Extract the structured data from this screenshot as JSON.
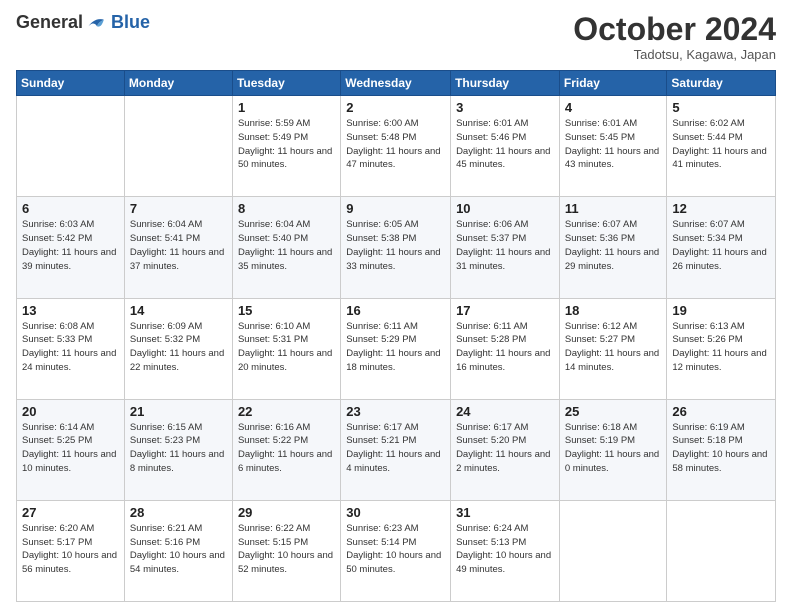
{
  "header": {
    "logo_general": "General",
    "logo_blue": "Blue",
    "month_title": "October 2024",
    "subtitle": "Tadotsu, Kagawa, Japan"
  },
  "days_of_week": [
    "Sunday",
    "Monday",
    "Tuesday",
    "Wednesday",
    "Thursday",
    "Friday",
    "Saturday"
  ],
  "weeks": [
    [
      {
        "day": "",
        "sunrise": "",
        "sunset": "",
        "daylight": ""
      },
      {
        "day": "",
        "sunrise": "",
        "sunset": "",
        "daylight": ""
      },
      {
        "day": "1",
        "sunrise": "Sunrise: 5:59 AM",
        "sunset": "Sunset: 5:49 PM",
        "daylight": "Daylight: 11 hours and 50 minutes."
      },
      {
        "day": "2",
        "sunrise": "Sunrise: 6:00 AM",
        "sunset": "Sunset: 5:48 PM",
        "daylight": "Daylight: 11 hours and 47 minutes."
      },
      {
        "day": "3",
        "sunrise": "Sunrise: 6:01 AM",
        "sunset": "Sunset: 5:46 PM",
        "daylight": "Daylight: 11 hours and 45 minutes."
      },
      {
        "day": "4",
        "sunrise": "Sunrise: 6:01 AM",
        "sunset": "Sunset: 5:45 PM",
        "daylight": "Daylight: 11 hours and 43 minutes."
      },
      {
        "day": "5",
        "sunrise": "Sunrise: 6:02 AM",
        "sunset": "Sunset: 5:44 PM",
        "daylight": "Daylight: 11 hours and 41 minutes."
      }
    ],
    [
      {
        "day": "6",
        "sunrise": "Sunrise: 6:03 AM",
        "sunset": "Sunset: 5:42 PM",
        "daylight": "Daylight: 11 hours and 39 minutes."
      },
      {
        "day": "7",
        "sunrise": "Sunrise: 6:04 AM",
        "sunset": "Sunset: 5:41 PM",
        "daylight": "Daylight: 11 hours and 37 minutes."
      },
      {
        "day": "8",
        "sunrise": "Sunrise: 6:04 AM",
        "sunset": "Sunset: 5:40 PM",
        "daylight": "Daylight: 11 hours and 35 minutes."
      },
      {
        "day": "9",
        "sunrise": "Sunrise: 6:05 AM",
        "sunset": "Sunset: 5:38 PM",
        "daylight": "Daylight: 11 hours and 33 minutes."
      },
      {
        "day": "10",
        "sunrise": "Sunrise: 6:06 AM",
        "sunset": "Sunset: 5:37 PM",
        "daylight": "Daylight: 11 hours and 31 minutes."
      },
      {
        "day": "11",
        "sunrise": "Sunrise: 6:07 AM",
        "sunset": "Sunset: 5:36 PM",
        "daylight": "Daylight: 11 hours and 29 minutes."
      },
      {
        "day": "12",
        "sunrise": "Sunrise: 6:07 AM",
        "sunset": "Sunset: 5:34 PM",
        "daylight": "Daylight: 11 hours and 26 minutes."
      }
    ],
    [
      {
        "day": "13",
        "sunrise": "Sunrise: 6:08 AM",
        "sunset": "Sunset: 5:33 PM",
        "daylight": "Daylight: 11 hours and 24 minutes."
      },
      {
        "day": "14",
        "sunrise": "Sunrise: 6:09 AM",
        "sunset": "Sunset: 5:32 PM",
        "daylight": "Daylight: 11 hours and 22 minutes."
      },
      {
        "day": "15",
        "sunrise": "Sunrise: 6:10 AM",
        "sunset": "Sunset: 5:31 PM",
        "daylight": "Daylight: 11 hours and 20 minutes."
      },
      {
        "day": "16",
        "sunrise": "Sunrise: 6:11 AM",
        "sunset": "Sunset: 5:29 PM",
        "daylight": "Daylight: 11 hours and 18 minutes."
      },
      {
        "day": "17",
        "sunrise": "Sunrise: 6:11 AM",
        "sunset": "Sunset: 5:28 PM",
        "daylight": "Daylight: 11 hours and 16 minutes."
      },
      {
        "day": "18",
        "sunrise": "Sunrise: 6:12 AM",
        "sunset": "Sunset: 5:27 PM",
        "daylight": "Daylight: 11 hours and 14 minutes."
      },
      {
        "day": "19",
        "sunrise": "Sunrise: 6:13 AM",
        "sunset": "Sunset: 5:26 PM",
        "daylight": "Daylight: 11 hours and 12 minutes."
      }
    ],
    [
      {
        "day": "20",
        "sunrise": "Sunrise: 6:14 AM",
        "sunset": "Sunset: 5:25 PM",
        "daylight": "Daylight: 11 hours and 10 minutes."
      },
      {
        "day": "21",
        "sunrise": "Sunrise: 6:15 AM",
        "sunset": "Sunset: 5:23 PM",
        "daylight": "Daylight: 11 hours and 8 minutes."
      },
      {
        "day": "22",
        "sunrise": "Sunrise: 6:16 AM",
        "sunset": "Sunset: 5:22 PM",
        "daylight": "Daylight: 11 hours and 6 minutes."
      },
      {
        "day": "23",
        "sunrise": "Sunrise: 6:17 AM",
        "sunset": "Sunset: 5:21 PM",
        "daylight": "Daylight: 11 hours and 4 minutes."
      },
      {
        "day": "24",
        "sunrise": "Sunrise: 6:17 AM",
        "sunset": "Sunset: 5:20 PM",
        "daylight": "Daylight: 11 hours and 2 minutes."
      },
      {
        "day": "25",
        "sunrise": "Sunrise: 6:18 AM",
        "sunset": "Sunset: 5:19 PM",
        "daylight": "Daylight: 11 hours and 0 minutes."
      },
      {
        "day": "26",
        "sunrise": "Sunrise: 6:19 AM",
        "sunset": "Sunset: 5:18 PM",
        "daylight": "Daylight: 10 hours and 58 minutes."
      }
    ],
    [
      {
        "day": "27",
        "sunrise": "Sunrise: 6:20 AM",
        "sunset": "Sunset: 5:17 PM",
        "daylight": "Daylight: 10 hours and 56 minutes."
      },
      {
        "day": "28",
        "sunrise": "Sunrise: 6:21 AM",
        "sunset": "Sunset: 5:16 PM",
        "daylight": "Daylight: 10 hours and 54 minutes."
      },
      {
        "day": "29",
        "sunrise": "Sunrise: 6:22 AM",
        "sunset": "Sunset: 5:15 PM",
        "daylight": "Daylight: 10 hours and 52 minutes."
      },
      {
        "day": "30",
        "sunrise": "Sunrise: 6:23 AM",
        "sunset": "Sunset: 5:14 PM",
        "daylight": "Daylight: 10 hours and 50 minutes."
      },
      {
        "day": "31",
        "sunrise": "Sunrise: 6:24 AM",
        "sunset": "Sunset: 5:13 PM",
        "daylight": "Daylight: 10 hours and 49 minutes."
      },
      {
        "day": "",
        "sunrise": "",
        "sunset": "",
        "daylight": ""
      },
      {
        "day": "",
        "sunrise": "",
        "sunset": "",
        "daylight": ""
      }
    ]
  ]
}
